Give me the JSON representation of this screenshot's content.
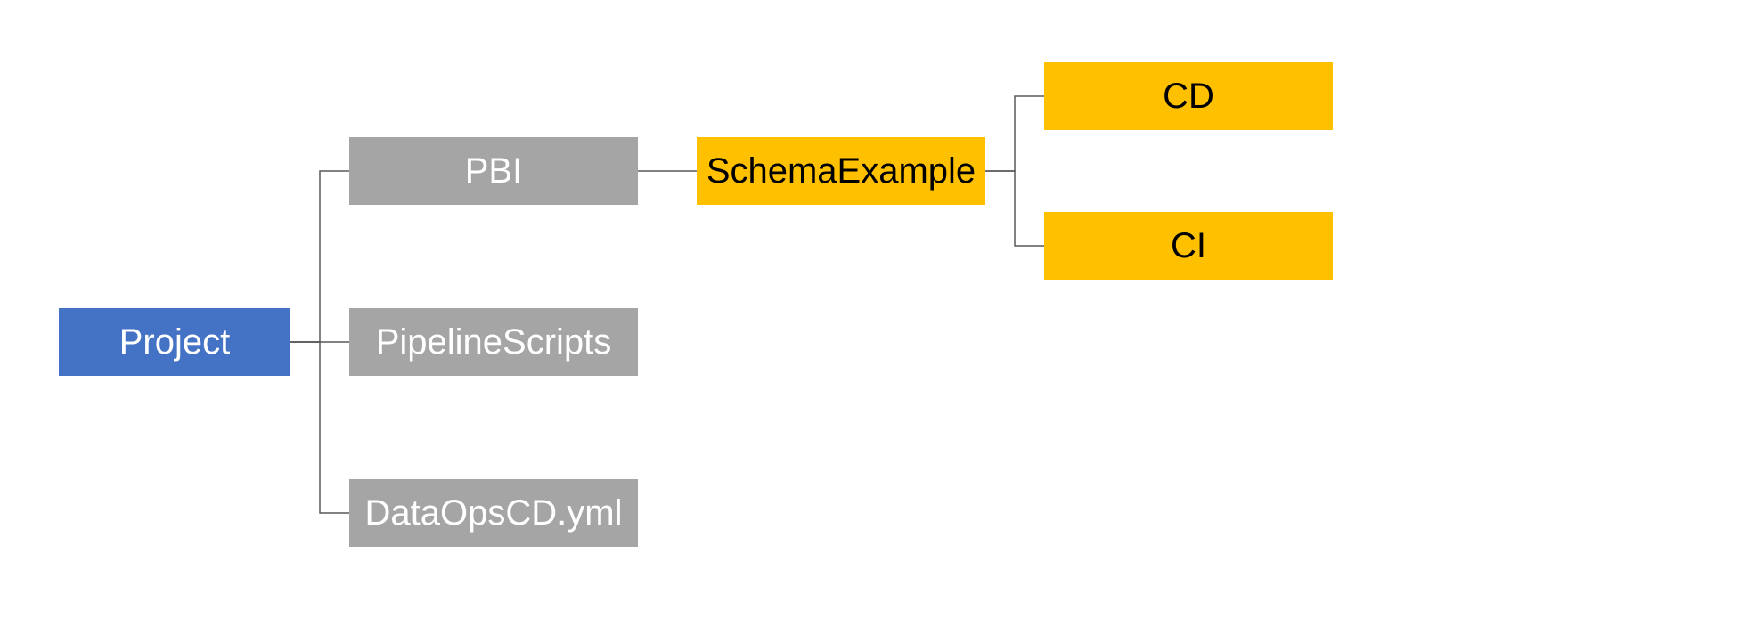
{
  "nodes": {
    "project": {
      "label": "Project"
    },
    "pbi": {
      "label": "PBI"
    },
    "pipelinescripts": {
      "label": "PipelineScripts"
    },
    "dataopscd": {
      "label": "DataOpsCD.yml"
    },
    "schemaexample": {
      "label": "SchemaExample"
    },
    "cd": {
      "label": "CD"
    },
    "ci": {
      "label": "CI"
    }
  },
  "colors": {
    "blue": "#4472C4",
    "gray": "#A5A5A5",
    "orange": "#FFC000",
    "line": "#595959"
  }
}
